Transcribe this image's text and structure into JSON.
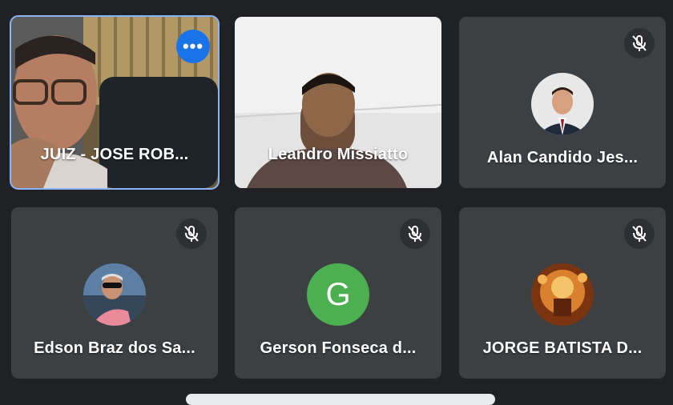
{
  "participants": [
    {
      "name": "JUIZ - JOSE ROB...",
      "active": true,
      "mic_icon": "more-options-icon"
    },
    {
      "name": "Leandro Missiatto",
      "active": false
    },
    {
      "name": "Alan Candido Jes...",
      "active": false,
      "mic_icon": "mic-off-icon"
    },
    {
      "name": "Edson Braz dos Sa...",
      "active": false,
      "mic_icon": "mic-off-icon"
    },
    {
      "name": "Gerson Fonseca d...",
      "active": false,
      "mic_icon": "mic-off-icon",
      "avatar_letter": "G",
      "avatar_color": "#4caf50"
    },
    {
      "name": "JORGE BATISTA D...",
      "active": false,
      "mic_icon": "mic-off-icon"
    }
  ],
  "more_options_label": "•••",
  "colors": {
    "background": "#202124",
    "tile": "#3c4043",
    "active_border": "#8ab4f8",
    "accent": "#1a73e8"
  }
}
